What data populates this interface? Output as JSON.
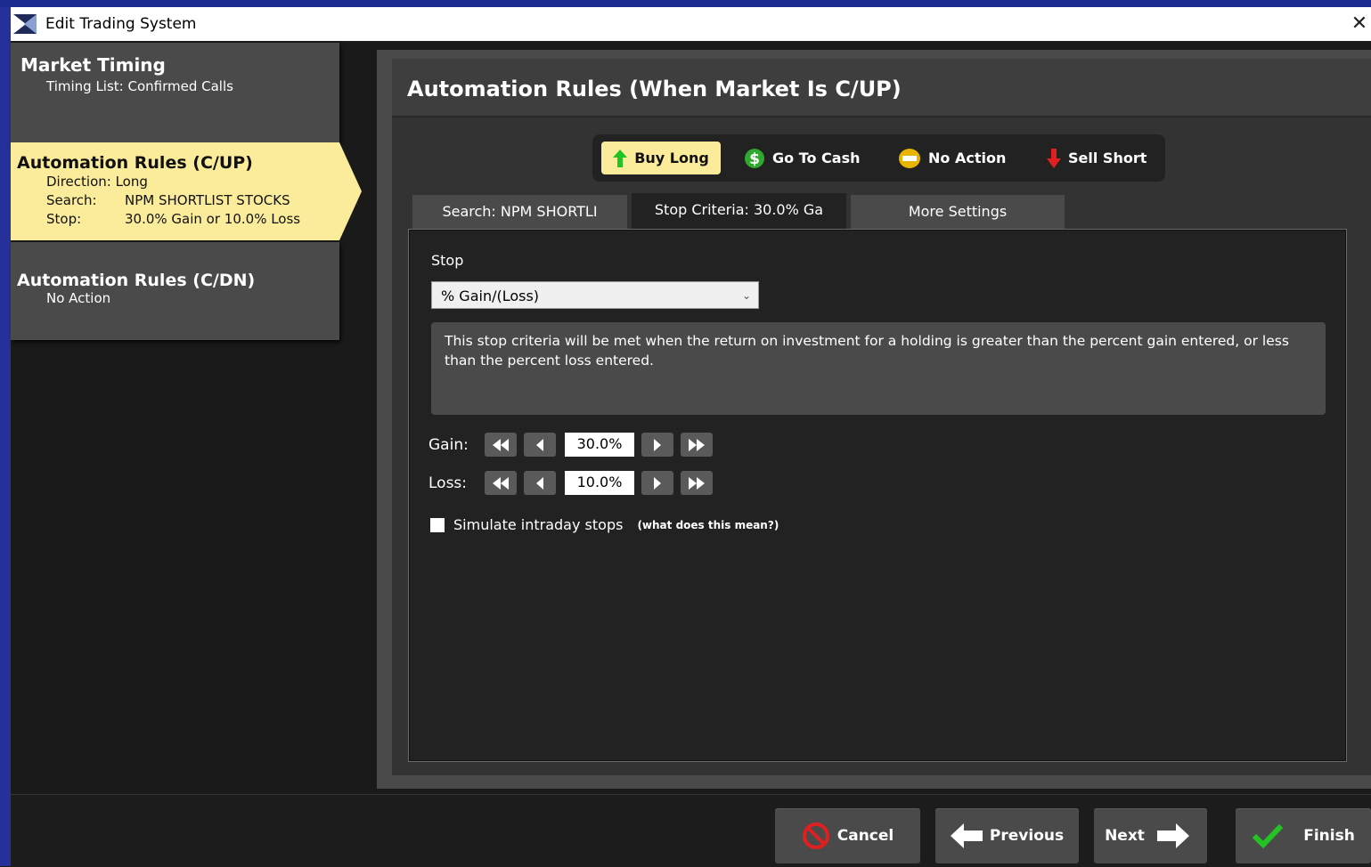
{
  "window": {
    "title": "Edit Trading System",
    "close_glyph": "✕"
  },
  "sidebar": {
    "market_timing": {
      "title": "Market Timing",
      "subtitle": "Timing List: Confirmed Calls"
    },
    "rules_up": {
      "title": "Automation Rules (C/UP)",
      "direction": "Direction: Long",
      "search_key": "Search:",
      "search_value": "NPM SHORTLIST STOCKS",
      "stop_key": "Stop:",
      "stop_value": "30.0% Gain or 10.0% Loss"
    },
    "rules_dn": {
      "title": "Automation Rules (C/DN)",
      "subtitle": "No Action"
    }
  },
  "panel": {
    "title": "Automation Rules (When Market Is C/UP)"
  },
  "actions": [
    {
      "label": "Buy Long",
      "icon": "green-up-arrow-icon",
      "selected": true
    },
    {
      "label": "Go To Cash",
      "icon": "dollar-icon",
      "selected": false
    },
    {
      "label": "No Action",
      "icon": "no-entry-icon",
      "selected": false
    },
    {
      "label": "Sell Short",
      "icon": "red-down-arrow-icon",
      "selected": false
    }
  ],
  "tabs": {
    "search": "Search:  NPM SHORTLI",
    "stop": "Stop Criteria: 30.0% Ga",
    "more": "More Settings"
  },
  "stop_form": {
    "label": "Stop",
    "selected_type": "% Gain/(Loss)",
    "description": "This stop criteria will be met when the return on investment for a holding is greater than the percent gain entered, or less than the percent loss entered.",
    "gain_label": "Gain:",
    "gain_value": "30.0%",
    "loss_label": "Loss:",
    "loss_value": "10.0%",
    "simulate_label": "Simulate intraday stops",
    "simulate_checked": false,
    "help_link": "(what does this mean?)"
  },
  "footer": {
    "cancel": "Cancel",
    "previous": "Previous",
    "next": "Next",
    "finish": "Finish"
  },
  "colors": {
    "selected_bg": "#fbec9b",
    "panel_bg": "#333333",
    "accent_green": "#22c322",
    "accent_red": "#e02020"
  }
}
